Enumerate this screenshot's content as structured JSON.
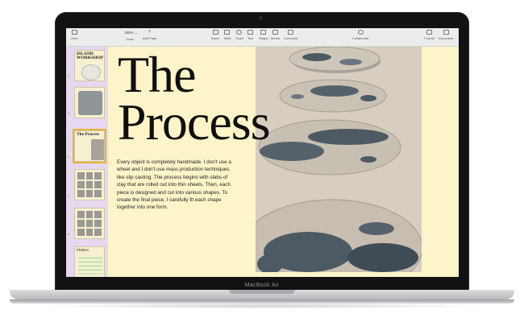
{
  "device": {
    "brand_label": "MacBook Air"
  },
  "toolbar": {
    "zoom": "150% ⌄",
    "items": [
      {
        "label": "View",
        "icon": "sidebar-view-icon"
      },
      {
        "label": "Zoom",
        "icon": "zoom-icon"
      },
      {
        "label": "Add Page",
        "icon": "add-page-icon"
      },
      {
        "label": "Insert",
        "icon": "insert-icon"
      },
      {
        "label": "Table",
        "icon": "table-icon"
      },
      {
        "label": "Chart",
        "icon": "chart-icon"
      },
      {
        "label": "Text",
        "icon": "text-icon"
      },
      {
        "label": "Shape",
        "icon": "shape-icon"
      },
      {
        "label": "Media",
        "icon": "media-icon"
      },
      {
        "label": "Comment",
        "icon": "comment-icon"
      },
      {
        "label": "Collaborate",
        "icon": "collaborate-icon"
      },
      {
        "label": "Format",
        "icon": "format-brush-icon"
      },
      {
        "label": "Document",
        "icon": "document-icon"
      }
    ]
  },
  "sidebar": {
    "thumbnails": [
      {
        "number": "1",
        "title": "ISLAND WORKSHOP",
        "selected": false
      },
      {
        "number": "2",
        "title": "",
        "selected": false
      },
      {
        "number": "3",
        "title": "The Process",
        "selected": true
      },
      {
        "number": "4",
        "title": "",
        "selected": false
      },
      {
        "number": "5",
        "title": "",
        "selected": false
      },
      {
        "number": "6",
        "title": "Orders",
        "selected": false
      }
    ]
  },
  "page": {
    "heading_line1": "The",
    "heading_line2": "Process",
    "body": "Every object is completely handmade. I don't use a wheel and I don't use mass production techniques like slip casting. The process begins with slabs of clay that are rolled out into thin sheets. Then, each piece is designed and cut into various shapes. To create the final piece, I carefully fit each shape together into one form."
  },
  "colors": {
    "page_bg": "#fdf5c9",
    "sidebar_bg": "#e6d8ef",
    "selection": "#e8b23a",
    "glaze": "#4d5a63"
  }
}
